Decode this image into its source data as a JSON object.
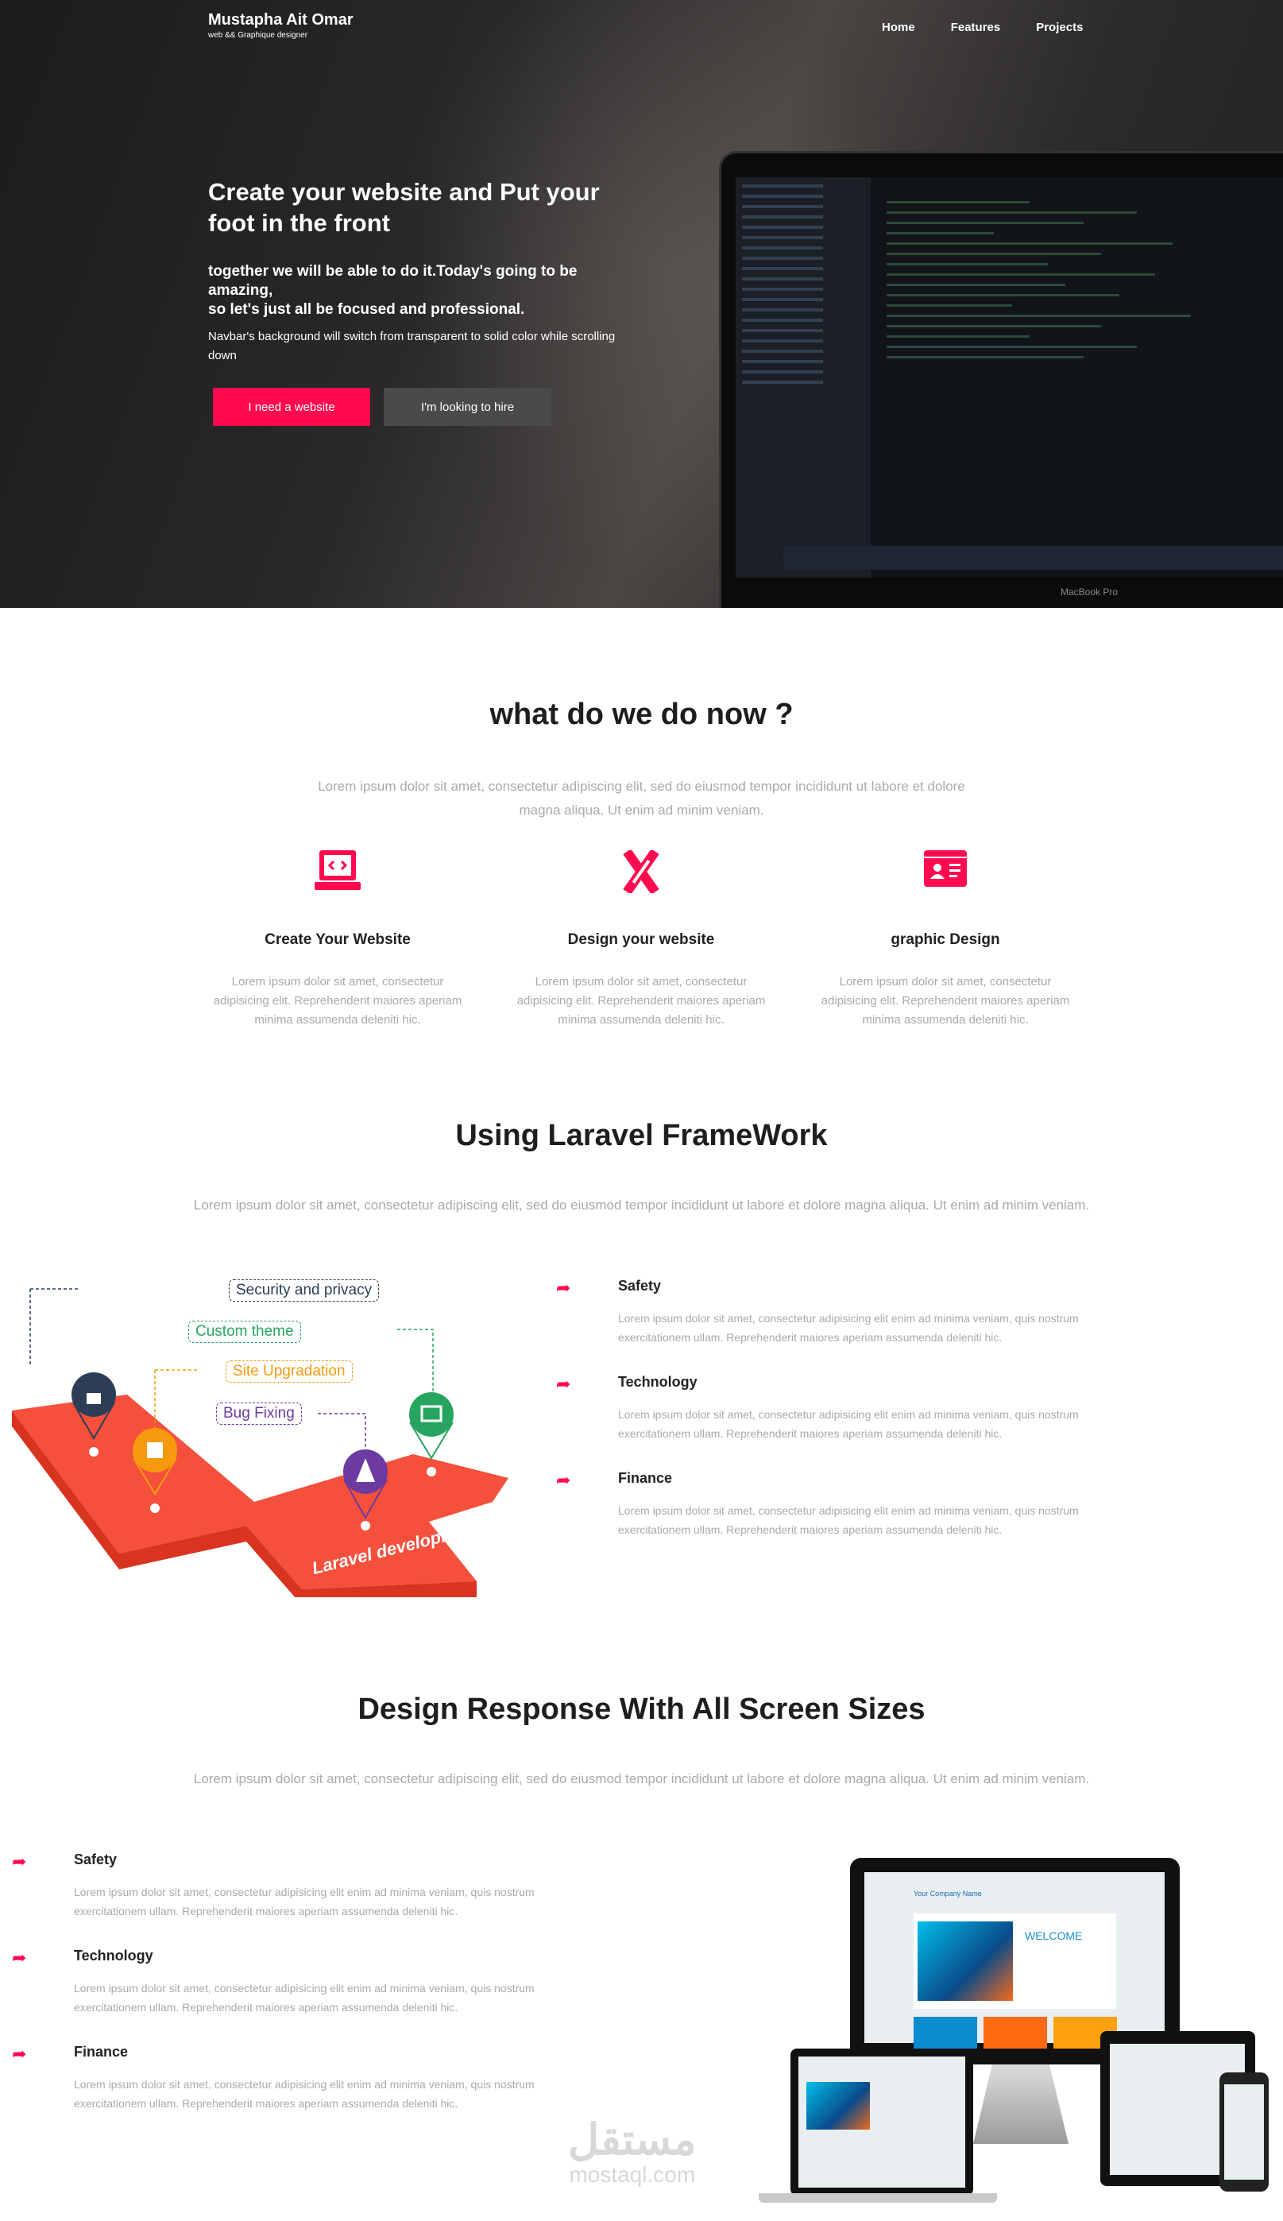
{
  "nav": {
    "brand": "Mustapha Ait Omar",
    "tagline": "web && Graphique designer",
    "links": [
      "Home",
      "Features",
      "Projects"
    ]
  },
  "hero": {
    "title": "Create your website and Put your foot in the front",
    "subtitle_1": "together we will be able to do it.Today's going to be amazing,",
    "subtitle_2": "so let's just all be focused and professional.",
    "note": "Navbar's background will switch from transparent to solid color while scrolling down",
    "primary_button": "I need a website",
    "secondary_button": "I'm looking to hire",
    "laptop_label": "MacBook Pro"
  },
  "services": {
    "title": "what do we do now ?",
    "intro": "Lorem ipsum dolor sit amet, consectetur adipiscing elit, sed do eiusmod tempor incididunt ut labore et dolore magna aliqua. Ut enim ad minim veniam.",
    "cards": [
      {
        "icon": "laptop-code-icon",
        "title": "Create Your Website",
        "text": "Lorem ipsum dolor sit amet, consectetur adipisicing elit. Reprehenderit maiores aperiam minima assumenda deleniti hic."
      },
      {
        "icon": "pencil-ruler-icon",
        "title": "Design your website",
        "text": "Lorem ipsum dolor sit amet, consectetur adipisicing elit. Reprehenderit maiores aperiam minima assumenda deleniti hic."
      },
      {
        "icon": "id-card-icon",
        "title": "graphic Design",
        "text": "Lorem ipsum dolor sit amet, consectetur adipisicing elit. Reprehenderit maiores aperiam minima assumenda deleniti hic."
      }
    ]
  },
  "laravel": {
    "title": "Using Laravel FrameWork",
    "intro": "Lorem ipsum dolor sit amet, consectetur adipiscing elit, sed do eiusmod tempor incididunt ut labore et dolore magna aliqua. Ut enim ad minim veniam.",
    "illustration": {
      "tags": [
        "Security and privacy",
        "Custom theme",
        "Site Upgradation",
        "Bug Fixing"
      ],
      "platform_label": "Laravel development"
    },
    "features": [
      {
        "title": "Safety",
        "text": "Lorem ipsum dolor sit amet, consectetur adipisicing elit enim ad minima veniam, quis nostrum exercitationem ullam. Reprehenderit maiores aperiam assumenda deleniti hic."
      },
      {
        "title": "Technology",
        "text": "Lorem ipsum dolor sit amet, consectetur adipisicing elit enim ad minima veniam, quis nostrum exercitationem ullam. Reprehenderit maiores aperiam assumenda deleniti hic."
      },
      {
        "title": "Finance",
        "text": "Lorem ipsum dolor sit amet, consectetur adipisicing elit enim ad minima veniam, quis nostrum exercitationem ullam. Reprehenderit maiores aperiam assumenda deleniti hic."
      }
    ]
  },
  "responsive": {
    "title": "Design Response With All Screen Sizes",
    "intro": "Lorem ipsum dolor sit amet, consectetur adipiscing elit, sed do eiusmod tempor incididunt ut labore et dolore magna aliqua. Ut enim ad minim veniam.",
    "features": [
      {
        "title": "Safety",
        "text": "Lorem ipsum dolor sit amet, consectetur adipisicing elit enim ad minima veniam, quis nostrum exercitationem ullam. Reprehenderit maiores aperiam assumenda deleniti hic."
      },
      {
        "title": "Technology",
        "text": "Lorem ipsum dolor sit amet, consectetur adipisicing elit enim ad minima veniam, quis nostrum exercitationem ullam. Reprehenderit maiores aperiam assumenda deleniti hic."
      },
      {
        "title": "Finance",
        "text": "Lorem ipsum dolor sit amet, consectetur adipisicing elit enim ad minima veniam, quis nostrum exercitationem ullam. Reprehenderit maiores aperiam assumenda deleniti hic."
      }
    ],
    "mockup": {
      "company": "Your Company Name",
      "welcome": "WELCOME"
    }
  },
  "watermark": {
    "arabic": "مستقل",
    "latin": "mostaql.com"
  },
  "colors": {
    "accent": "#ff0a4e",
    "dark_button": "#4a4a4a",
    "platform": "#f5503c"
  }
}
